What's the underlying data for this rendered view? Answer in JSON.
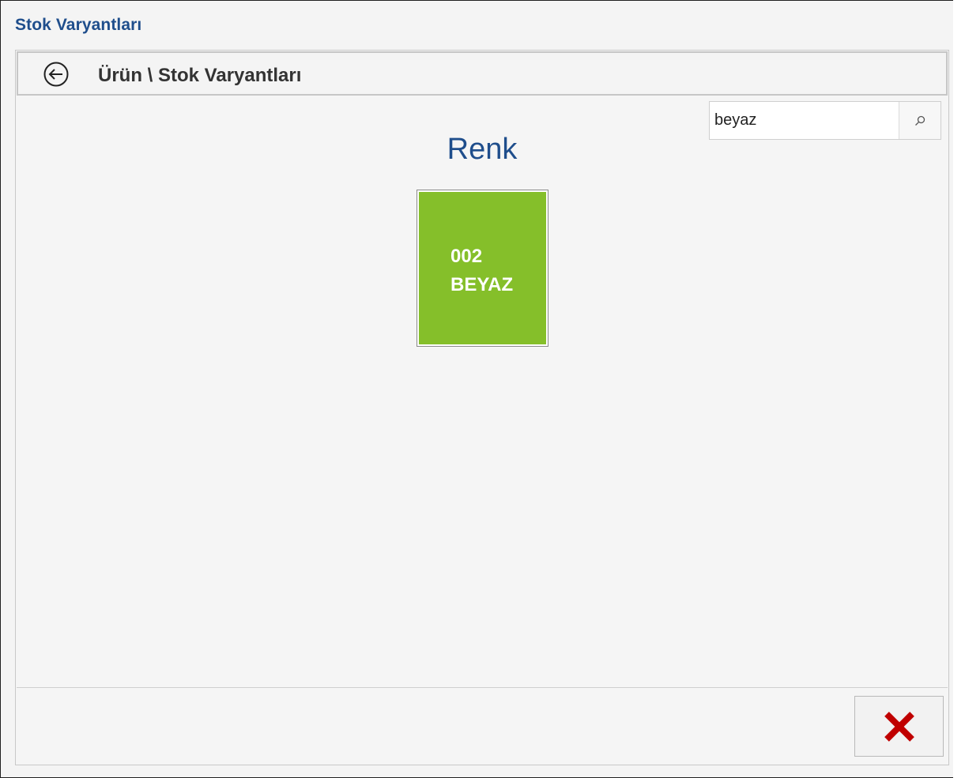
{
  "window": {
    "title": "Stok Varyantları"
  },
  "nav": {
    "back_icon": "circle-arrow-left-icon",
    "breadcrumb": "Ürün \\ Stok Varyantları"
  },
  "search": {
    "value": "beyaz",
    "icon": "search-icon"
  },
  "section": {
    "title": "Renk"
  },
  "variants": [
    {
      "code": "002",
      "name": "BEYAZ",
      "color": "#85bf2a"
    }
  ],
  "footer": {
    "close_icon": "close-x-icon",
    "close_color": "#c00000"
  }
}
